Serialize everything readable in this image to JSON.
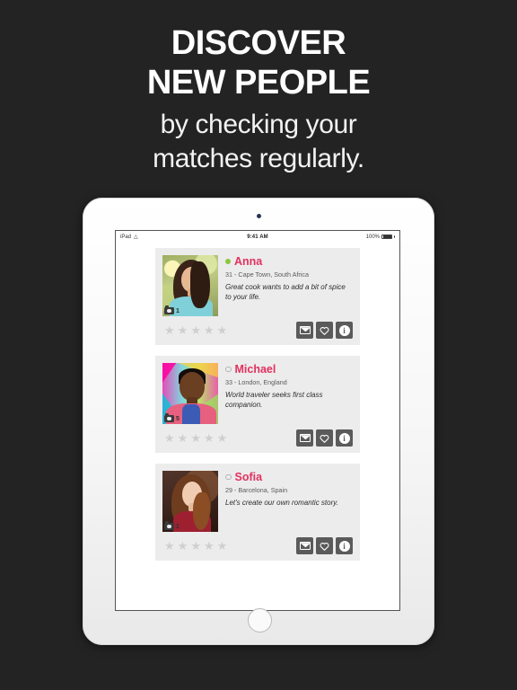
{
  "headline": {
    "line1": "DISCOVER",
    "line2": "NEW PEOPLE",
    "line3": "by checking your",
    "line4": "matches regularly."
  },
  "colors": {
    "background": "#232323",
    "name_pink": "#e2315f",
    "online_green": "#8cc63e",
    "card_gray": "#ececec",
    "button_gray": "#5a5a5a",
    "star_gray": "#cfcfcf"
  },
  "device": {
    "type": "iPad",
    "bezel_color": "#fbfbfb"
  },
  "status_bar": {
    "carrier": "iPad",
    "wifi_icon": "wifi-icon",
    "time": "9:41 AM",
    "battery_percent": "100%",
    "battery_icon": "battery-full-icon"
  },
  "profiles": [
    {
      "name": "Anna",
      "online": true,
      "status_icon": "online-dot-icon",
      "meta": "31 - Cape Town, South Africa",
      "bio": "Great cook wants to add a bit of spice to your life.",
      "photo_count": "1",
      "photo_icon": "camera-icon",
      "rating": 0,
      "stars": [
        "★",
        "★",
        "★",
        "★",
        "★"
      ],
      "actions": [
        {
          "name": "message-button",
          "icon": "envelope-icon"
        },
        {
          "name": "favorite-button",
          "icon": "heart-outline-icon"
        },
        {
          "name": "info-button",
          "icon": "info-circle-icon",
          "label": "i"
        }
      ]
    },
    {
      "name": "Michael",
      "online": false,
      "status_icon": "offline-dot-icon",
      "meta": "33 - London, England",
      "bio": "World traveler seeks first class companion.",
      "photo_count": "5",
      "photo_icon": "camera-icon",
      "rating": 0,
      "stars": [
        "★",
        "★",
        "★",
        "★",
        "★"
      ],
      "actions": [
        {
          "name": "message-button",
          "icon": "envelope-icon"
        },
        {
          "name": "favorite-button",
          "icon": "heart-outline-icon"
        },
        {
          "name": "info-button",
          "icon": "info-circle-icon",
          "label": "i"
        }
      ]
    },
    {
      "name": "Sofia",
      "online": false,
      "status_icon": "offline-dot-icon",
      "meta": "29 - Barcelona, Spain",
      "bio": "Let's create our own romantic story.",
      "photo_count": "1",
      "photo_icon": "camera-icon",
      "rating": 0,
      "stars": [
        "★",
        "★",
        "★",
        "★",
        "★"
      ],
      "actions": [
        {
          "name": "message-button",
          "icon": "envelope-icon"
        },
        {
          "name": "favorite-button",
          "icon": "heart-outline-icon"
        },
        {
          "name": "info-button",
          "icon": "info-circle-icon",
          "label": "i"
        }
      ]
    }
  ]
}
